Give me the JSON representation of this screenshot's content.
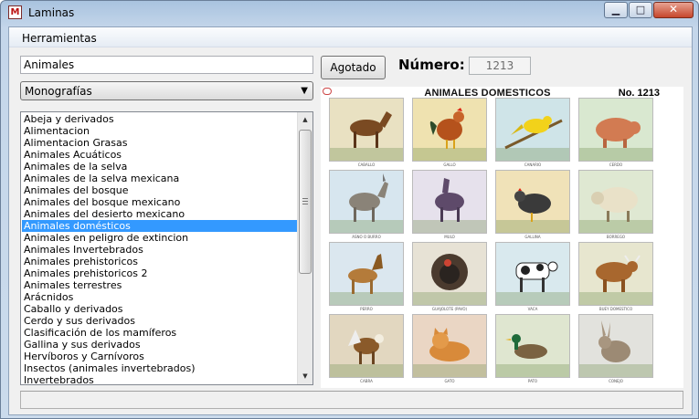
{
  "window": {
    "title": "Laminas",
    "minimize_glyph": "▁",
    "maximize_glyph": "□",
    "close_glyph": "✕"
  },
  "menu": {
    "herramientas": "Herramientas"
  },
  "search": {
    "value": "Animales"
  },
  "category_select": {
    "value": "Monografías",
    "arrow": "▼"
  },
  "list": {
    "items": [
      "Abeja y derivados",
      "Alimentacion",
      "Alimentacion Grasas",
      "Animales Acuáticos",
      "Animales de la selva",
      "Animales de la selva mexicana",
      "Animales del bosque",
      "Animales del bosque mexicano",
      "Animales del desierto mexicano",
      "Animales domésticos",
      "Animales en peligro de extincion",
      "Animales Invertebrados",
      "Animales prehistoricos",
      "Animales prehistoricos 2",
      "Animales terrestres",
      "Arácnidos",
      "Caballo y derivados",
      "Cerdo y sus derivados",
      "Clasificación de los mamíferos",
      "Gallina y sus derivados",
      "Hervíboros y Carnívoros",
      "Insectos (animales invertebrados)",
      "Invertebrados"
    ],
    "selected_index": 9,
    "scroll_up": "▲",
    "scroll_down": "▼"
  },
  "actions": {
    "agotado_label": "Agotado"
  },
  "numero": {
    "label": "Número:",
    "value": "1213"
  },
  "poster": {
    "title": "ANIMALES DOMESTICOS",
    "number": "No. 1213",
    "cells": [
      {
        "caption": "CABALLO",
        "animal": "horse-icon",
        "bg": "#e9e1c2"
      },
      {
        "caption": "GALLO",
        "animal": "rooster-icon",
        "bg": "#efe2b0"
      },
      {
        "caption": "CANARIO",
        "animal": "canary-icon",
        "bg": "#cfe4e8"
      },
      {
        "caption": "CERDO",
        "animal": "pig-icon",
        "bg": "#d9e8d0"
      },
      {
        "caption": "ASNO O BURRO",
        "animal": "donkey-icon",
        "bg": "#d7e6ef"
      },
      {
        "caption": "MULO",
        "animal": "mule-icon",
        "bg": "#e6e1ec"
      },
      {
        "caption": "GALLINA",
        "animal": "hen-icon",
        "bg": "#f0e2b8"
      },
      {
        "caption": "BORREGO",
        "animal": "sheep-icon",
        "bg": "#dfe8d2"
      },
      {
        "caption": "PERRO",
        "animal": "dog-icon",
        "bg": "#dbe7ef"
      },
      {
        "caption": "GUAJOLOTE (PAVO)",
        "animal": "turkey-icon",
        "bg": "#e7e2d5"
      },
      {
        "caption": "VACA",
        "animal": "cow-icon",
        "bg": "#d9e9ee"
      },
      {
        "caption": "BUEY DOMESTICO",
        "animal": "ox-icon",
        "bg": "#e7e6cf"
      },
      {
        "caption": "CABRA",
        "animal": "goat-icon",
        "bg": "#e2d7c0"
      },
      {
        "caption": "GATO",
        "animal": "cat-icon",
        "bg": "#ead6c4"
      },
      {
        "caption": "PATO",
        "animal": "duck-icon",
        "bg": "#dfe6d0"
      },
      {
        "caption": "CONEJO",
        "animal": "rabbit-icon",
        "bg": "#e2e2dd"
      }
    ]
  }
}
